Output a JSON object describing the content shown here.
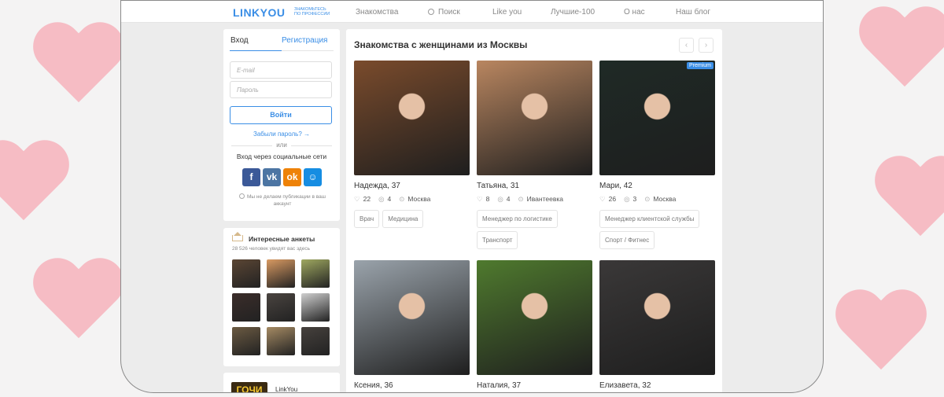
{
  "nav": {
    "logo": "LINKYOU",
    "logo_tagline": "ЗНАКОМЬТЕСЬ ПО ПРОФЕССИИ",
    "items": [
      "Знакомства",
      "Поиск",
      "Like you",
      "Лучшие-100",
      "О нас",
      "Наш блог"
    ]
  },
  "login": {
    "tab_login": "Вход",
    "tab_register": "Регистрация",
    "email_placeholder": "E-mail",
    "password_placeholder": "Пароль",
    "submit": "Войти",
    "forgot": "Забыли пароль? →",
    "or": "или",
    "social_title": "Вход через социальные сети",
    "socials": [
      "facebook-icon",
      "vk-icon",
      "odnoklassniki-icon",
      "moimir-icon"
    ],
    "notice": "Мы не делаем публикации в ваш аккаунт"
  },
  "interesting": {
    "title": "Интересные анкеты",
    "subtitle": "28 526 человек увидят вас здесь",
    "thumb_colors": [
      "#5b4634",
      "#d99a62",
      "#9fa860",
      "#3b2d2a",
      "#4a4440",
      "#cfcfcf",
      "#6b5a42",
      "#a58a63",
      "#46413d"
    ]
  },
  "promo": {
    "logo": "ГОЧИ",
    "label": "LinkYou"
  },
  "main": {
    "title": "Знакомства с женщинами из Москвы",
    "prev": "‹",
    "next": "›",
    "profiles": [
      {
        "name": "Надежда, 37",
        "likes": "22",
        "photos": "4",
        "city": "Москва",
        "tags": [
          "Врач",
          "Медицина"
        ],
        "premium": "",
        "photo_color": "#7a4b2c"
      },
      {
        "name": "Татьяна, 31",
        "likes": "8",
        "photos": "4",
        "city": "Ивантеевка",
        "tags": [
          "Менеджер по логистике",
          "Транспорт"
        ],
        "premium": "",
        "photo_color": "#b98660"
      },
      {
        "name": "Мари, 42",
        "likes": "26",
        "photos": "3",
        "city": "Москва",
        "tags": [
          "Менеджер клиентской службы",
          "Спорт / Фитнес"
        ],
        "premium": "Premium",
        "photo_color": "#1f2a26"
      },
      {
        "name": "Ксения, 36",
        "likes": "",
        "photos": "",
        "city": "",
        "tags": [],
        "premium": "",
        "photo_color": "#9aa3ab"
      },
      {
        "name": "Наталия, 37",
        "likes": "",
        "photos": "",
        "city": "",
        "tags": [],
        "premium": "",
        "photo_color": "#4f7a2e"
      },
      {
        "name": "Елизавета, 32",
        "likes": "",
        "photos": "",
        "city": "",
        "tags": [],
        "premium": "",
        "photo_color": "#3a3838"
      }
    ]
  }
}
